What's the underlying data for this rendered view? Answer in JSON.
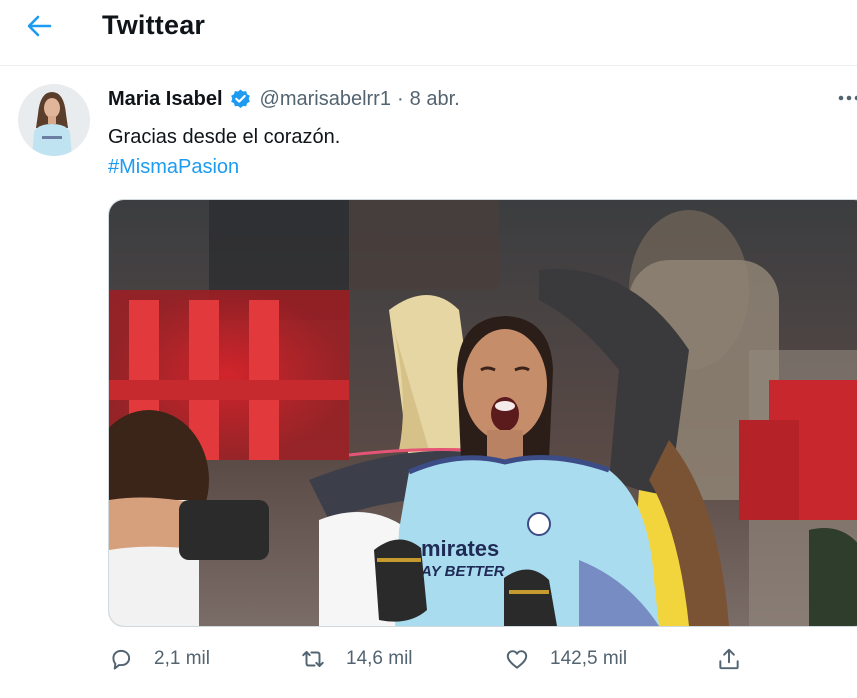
{
  "header": {
    "back_icon": "arrow-left-icon",
    "title": "Twittear",
    "accent": "#1d9bf0"
  },
  "tweet": {
    "author_name": "Maria Isabel",
    "verified_icon": "verified-badge-icon",
    "handle": "@marisabelrr1",
    "separator": "·",
    "date": "8 abr.",
    "more_icon": "more-dots-icon",
    "text": "Gracias desde el corazón.",
    "hashtag": "#MismaPasion",
    "media": {
      "jersey_sponsor_line1": "mirates",
      "jersey_sponsor_line2": "AY BETTER"
    },
    "actions": {
      "reply": {
        "icon": "reply-icon",
        "count": "2,1 mil"
      },
      "retweet": {
        "icon": "retweet-icon",
        "count": "14,6 mil"
      },
      "like": {
        "icon": "heart-icon",
        "count": "142,5 mil"
      },
      "share": {
        "icon": "share-icon"
      }
    }
  }
}
